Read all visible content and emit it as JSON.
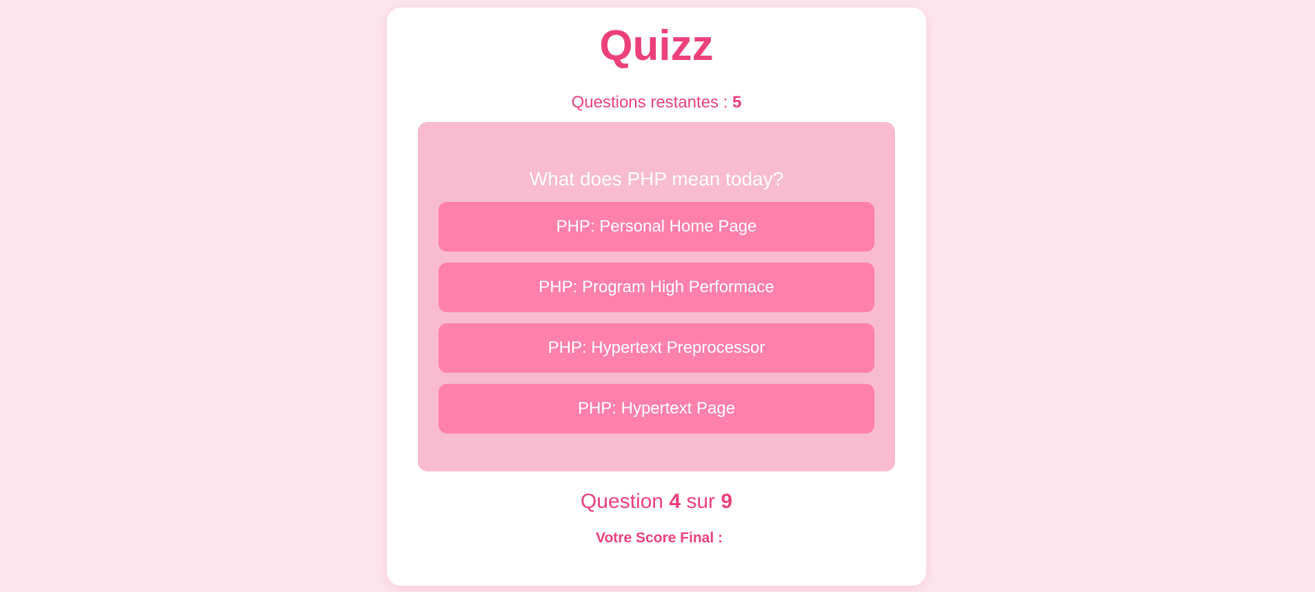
{
  "quiz": {
    "title": "Quizz",
    "remaining_label": "Questions restantes : ",
    "remaining_count": "5",
    "question": "What does PHP mean today?",
    "answers": [
      "PHP: Personal Home Page",
      "PHP: Program High Performace",
      "PHP: Hypertext Preprocessor",
      "PHP: Hypertext Page"
    ],
    "progress": {
      "prefix": "Question ",
      "current": "4",
      "middle": " sur ",
      "total": "9"
    },
    "score_label": "Votre Score Final :"
  },
  "colors": {
    "background": "#fce4ec",
    "accent": "#ec407a",
    "question_box": "#f8bbd0",
    "answer_button": "#ff80ab"
  }
}
